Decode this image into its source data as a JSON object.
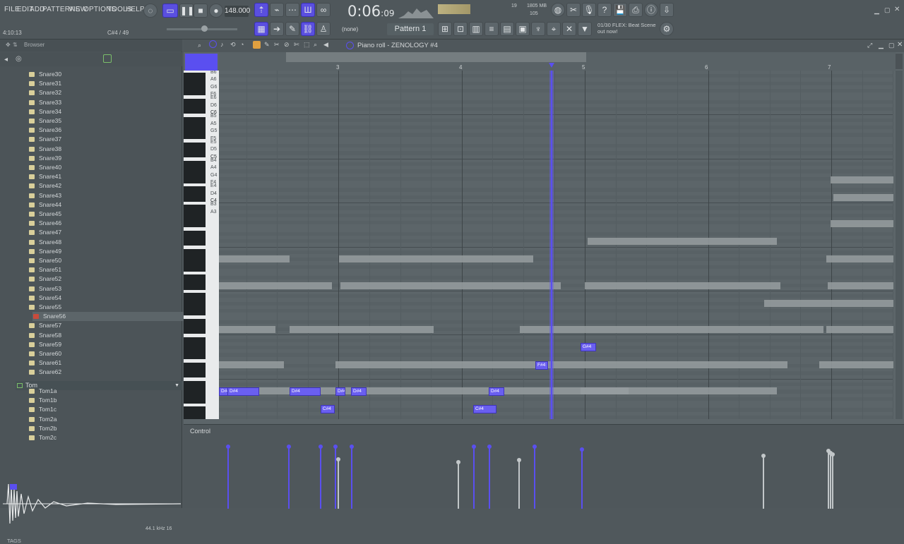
{
  "menu": [
    "FILE",
    "EDIT",
    "ADD",
    "PATTERNS",
    "VIEW",
    "OPTIONS",
    "TOOLS",
    "HELP"
  ],
  "transport": {
    "tempo": "148.000",
    "time": "0:06",
    "time_frac": ":09",
    "pattern": "Pattern 1",
    "channel_select": "(none)",
    "cpu_mem": "1805 MB",
    "cpu_num": "19",
    "poly": "105"
  },
  "hint": {
    "left": "4:10:13",
    "right": "C#4 / 49"
  },
  "news": {
    "line1": "01/30 FLEX: Beat Scene",
    "line2": "out now!"
  },
  "browser": {
    "title": "Browser",
    "items": [
      "Snare30",
      "Snare31",
      "Snare32",
      "Snare33",
      "Snare34",
      "Snare35",
      "Snare36",
      "Snare37",
      "Snare38",
      "Snare39",
      "Snare40",
      "Snare41",
      "Snare42",
      "Snare43",
      "Snare44",
      "Snare45",
      "Snare46",
      "Snare47",
      "Snare48",
      "Snare49",
      "Snare50",
      "Snare51",
      "Snare52",
      "Snare53",
      "Snare54",
      "Snare55",
      "Snare56",
      "Snare57",
      "Snare58",
      "Snare59",
      "Snare60",
      "Snare61",
      "Snare62"
    ],
    "selected": "Snare56",
    "folder": "Tom",
    "tom_items": [
      "Tom1a",
      "Tom1b",
      "Tom1c",
      "Tom2a",
      "Tom2b",
      "Tom2c"
    ],
    "sample_rate": "44.1 kHz 16",
    "tags": "TAGS"
  },
  "piano_roll": {
    "title": "Piano roll - ZENOLOGY #4",
    "control_label": "Control",
    "bars": [
      "3",
      "4",
      "5",
      "6",
      "7"
    ],
    "key_labels": [
      "B6",
      "A6",
      "G6",
      "F6",
      "E6",
      "D6",
      "C6",
      "B5",
      "A5",
      "G5",
      "F5",
      "E5",
      "D5",
      "C5",
      "B4",
      "A4",
      "G4",
      "F4",
      "E4",
      "D4",
      "C4",
      "B3",
      "A3"
    ],
    "notes": [
      {
        "label": "D#4"
      },
      {
        "label": "D#4"
      },
      {
        "label": "D#4"
      },
      {
        "label": "D#4"
      },
      {
        "label": "D#4"
      },
      {
        "label": "D#4"
      },
      {
        "label": "C#4"
      },
      {
        "label": "C#4"
      },
      {
        "label": "F#4"
      },
      {
        "label": "G#4"
      }
    ]
  },
  "colors": {
    "accent": "#5a4ff0",
    "bg": "#5c6569"
  }
}
